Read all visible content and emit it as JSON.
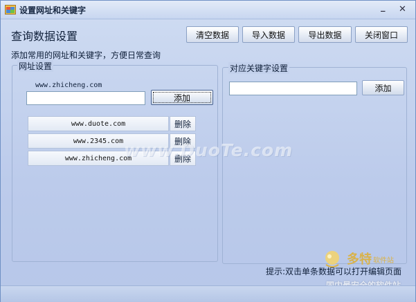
{
  "window": {
    "title": "设置网址和关键字",
    "minimize_glyph": "_",
    "close_glyph": "✕",
    "icon": "app-window-icon"
  },
  "header": {
    "title": "查询数据设置",
    "buttons": [
      {
        "label": "清空数据"
      },
      {
        "label": "导入数据"
      },
      {
        "label": "导出数据"
      },
      {
        "label": "关闭窗口"
      }
    ]
  },
  "subtitle": "添加常用的网址和关键字，方便日常查询",
  "url_group": {
    "legend": "网址设置",
    "hint": "www.zhicheng.com",
    "input_value": "",
    "add_label": "添加",
    "items": [
      {
        "url": "www.duote.com",
        "delete_label": "删除"
      },
      {
        "url": "www.2345.com",
        "delete_label": "删除"
      },
      {
        "url": "www.zhicheng.com",
        "delete_label": "删除"
      }
    ]
  },
  "keyword_group": {
    "legend": "对应关键字设置",
    "input_value": "",
    "add_label": "添加"
  },
  "tip": "提示:双击单条数据可以打开编辑页面",
  "watermark": "www.DuoTe.com",
  "logo": {
    "name": "多特",
    "sub": "软件站",
    "slogan": "国内最安全的软件站"
  }
}
